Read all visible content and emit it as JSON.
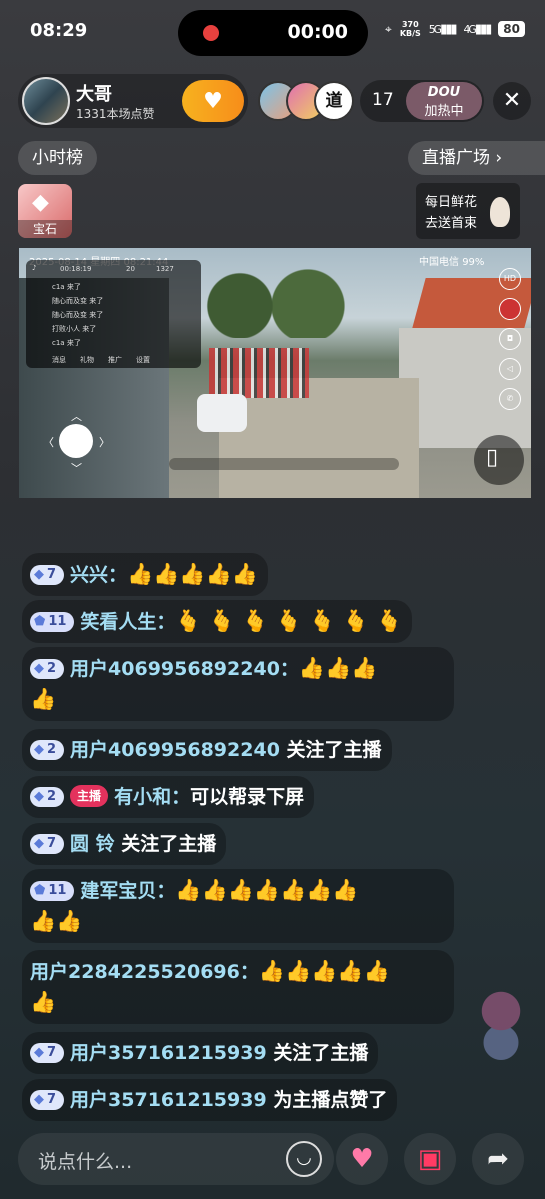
{
  "status_bar": {
    "time": "08:29",
    "record_time": "00:00",
    "net_speed_top": "370",
    "net_speed_unit": "KB/S",
    "network_1": "5G",
    "network_2": "4G",
    "battery": "80"
  },
  "host": {
    "name": "大哥",
    "likes": "1331本场点赞",
    "viewer_count": "17",
    "dou_label": "DOU",
    "promo": "加热中",
    "viewer_3_text": "道"
  },
  "chips": {
    "hourly_rank": "小时榜",
    "live_square": "直播广场"
  },
  "gem": {
    "label": "宝石"
  },
  "flower": {
    "line1": "每日鲜花",
    "line2": "去送首束"
  },
  "video": {
    "datetime": "2025-08-14 星期四 08:21:44",
    "carrier": "中国电信",
    "battery": "99%",
    "timer": "00:18:19",
    "likes": "20",
    "viewers": "1327",
    "chat_lines": [
      "c1a 来了",
      "随心而及变 来了",
      "随心而及变 来了",
      "打败小人 来了",
      "c1a 来了"
    ],
    "tabs": [
      "消息",
      "礼物",
      "推广",
      "设置"
    ],
    "hd_label": "HD"
  },
  "chat": [
    {
      "level": "7",
      "name": "兴兴：",
      "text": "",
      "emojis": "👍👍👍👍👍"
    },
    {
      "level": "11",
      "name": "笑看人生：",
      "text": "",
      "emojis": "🫰 🫰 🫰 🫰 🫰 🫰 🫰"
    },
    {
      "level": "2",
      "name": "用户4069956892240：",
      "text": "",
      "emojis": "👍👍👍",
      "emojis2": "👍"
    },
    {
      "level": "2",
      "name": "用户4069956892240",
      "text": " 关注了主播"
    },
    {
      "level": "2",
      "tag": "主播",
      "name": "有小和：",
      "text": "可以帮录下屏"
    },
    {
      "level": "7",
      "name": "圆 铃",
      "text": " 关注了主播"
    },
    {
      "level": "11",
      "name": "建军宝贝：",
      "text": "",
      "emojis": "👍👍👍👍👍👍👍",
      "emojis2": "👍👍"
    },
    {
      "name": "用户2284225520696：",
      "text": "",
      "emojis": "👍👍👍👍👍",
      "emojis2": "👍"
    },
    {
      "level": "7",
      "name": "用户357161215939",
      "text": " 关注了主播"
    },
    {
      "level": "7",
      "name": "用户357161215939",
      "text": " 为主播点赞了"
    }
  ],
  "bottom": {
    "placeholder": "说点什么..."
  },
  "icons": {
    "smile": "smile-icon",
    "heart": "heart-icon",
    "gift": "gift-icon",
    "share": "share-icon"
  }
}
